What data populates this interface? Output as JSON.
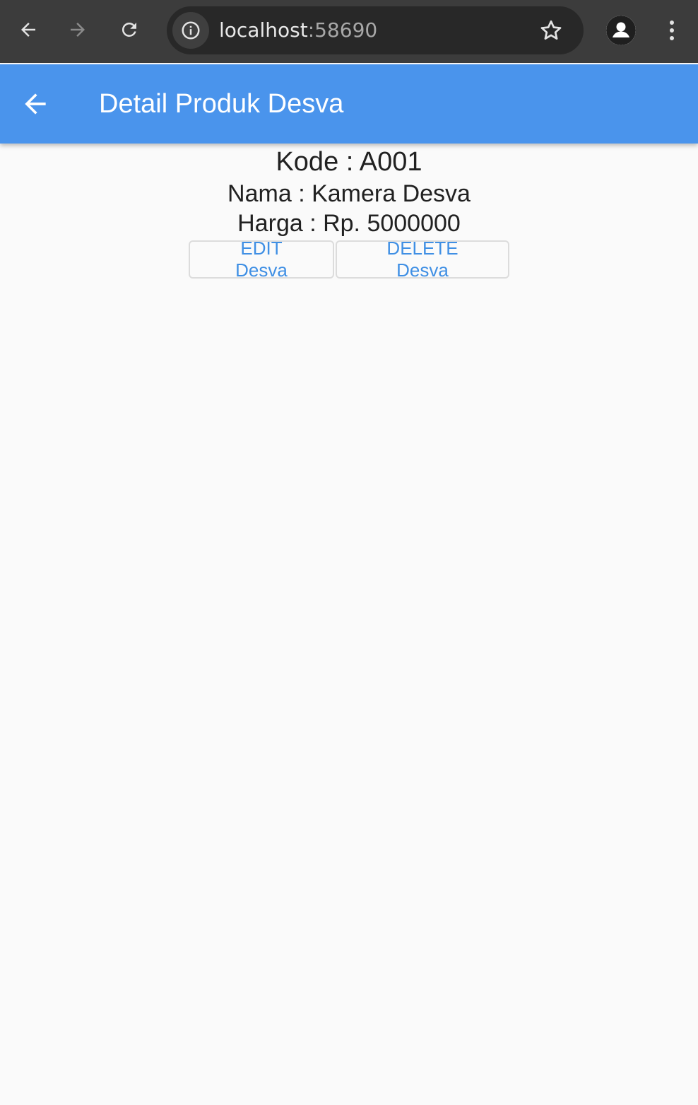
{
  "browser": {
    "url_host": "localhost",
    "url_port": ":58690"
  },
  "appbar": {
    "title": "Detail Produk Desva"
  },
  "product": {
    "kode": "Kode : A001",
    "nama": "Nama : Kamera Desva",
    "harga": "Harga : Rp. 5000000"
  },
  "actions": {
    "edit_label": "EDIT Desva",
    "delete_label": "DELETE Desva"
  },
  "colors": {
    "appbar": "#4a94ec",
    "button_text": "#3f8fe4",
    "browser_chrome": "#3c3c3c"
  },
  "icons": {
    "back": "arrow-left-icon",
    "forward": "arrow-right-icon",
    "reload": "reload-icon",
    "info": "info-icon",
    "bookmark": "star-icon",
    "profile": "profile-icon",
    "menu": "kebab-menu-icon",
    "appbar_back": "arrow-left-icon"
  }
}
